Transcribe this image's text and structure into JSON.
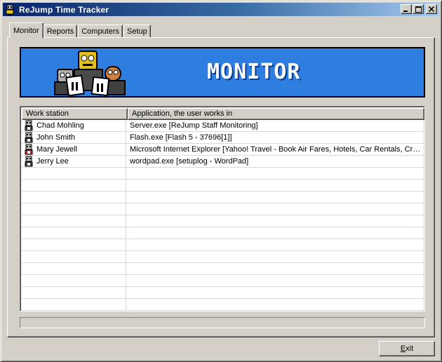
{
  "window": {
    "title": "ReJump Time Tracker",
    "app_icon": "robot-icon",
    "controls": [
      "minimize-icon",
      "maximize-icon",
      "close-icon"
    ]
  },
  "tabs": [
    {
      "label": "Monitor",
      "active": true
    },
    {
      "label": "Reports",
      "active": false
    },
    {
      "label": "Computers",
      "active": false
    },
    {
      "label": "Setup",
      "active": false
    }
  ],
  "banner": {
    "title": "MONITOR",
    "background_color": "#2d7ee0",
    "art": "robots-illustration"
  },
  "list": {
    "columns": [
      "Work station",
      "Application, the user works in"
    ],
    "rows": [
      {
        "station": "Chad Mohling",
        "application": "Server.exe  [ReJump Staff Monitoring]",
        "icon": "user-icon",
        "icon_color": "#404040"
      },
      {
        "station": "John Smith",
        "application": "Flash.exe  [Flash 5 - 37696[1]]",
        "icon": "user-icon",
        "icon_color": "#404040"
      },
      {
        "station": "Mary Jewell",
        "application": "Microsoft Internet Explorer [Yahoo! Travel - Book Air Fares, Hotels, Car Rentals, Cruises, Vacation Packages]",
        "icon": "user-icon",
        "icon_color": "#c02020"
      },
      {
        "station": "Jerry Lee",
        "application": "wordpad.exe  [setuplog - WordPad]",
        "icon": "user-icon",
        "icon_color": "#404040"
      }
    ],
    "empty_rows": 12
  },
  "footer": {
    "exit_prefix": "",
    "exit_accel": "E",
    "exit_rest": "xit"
  }
}
